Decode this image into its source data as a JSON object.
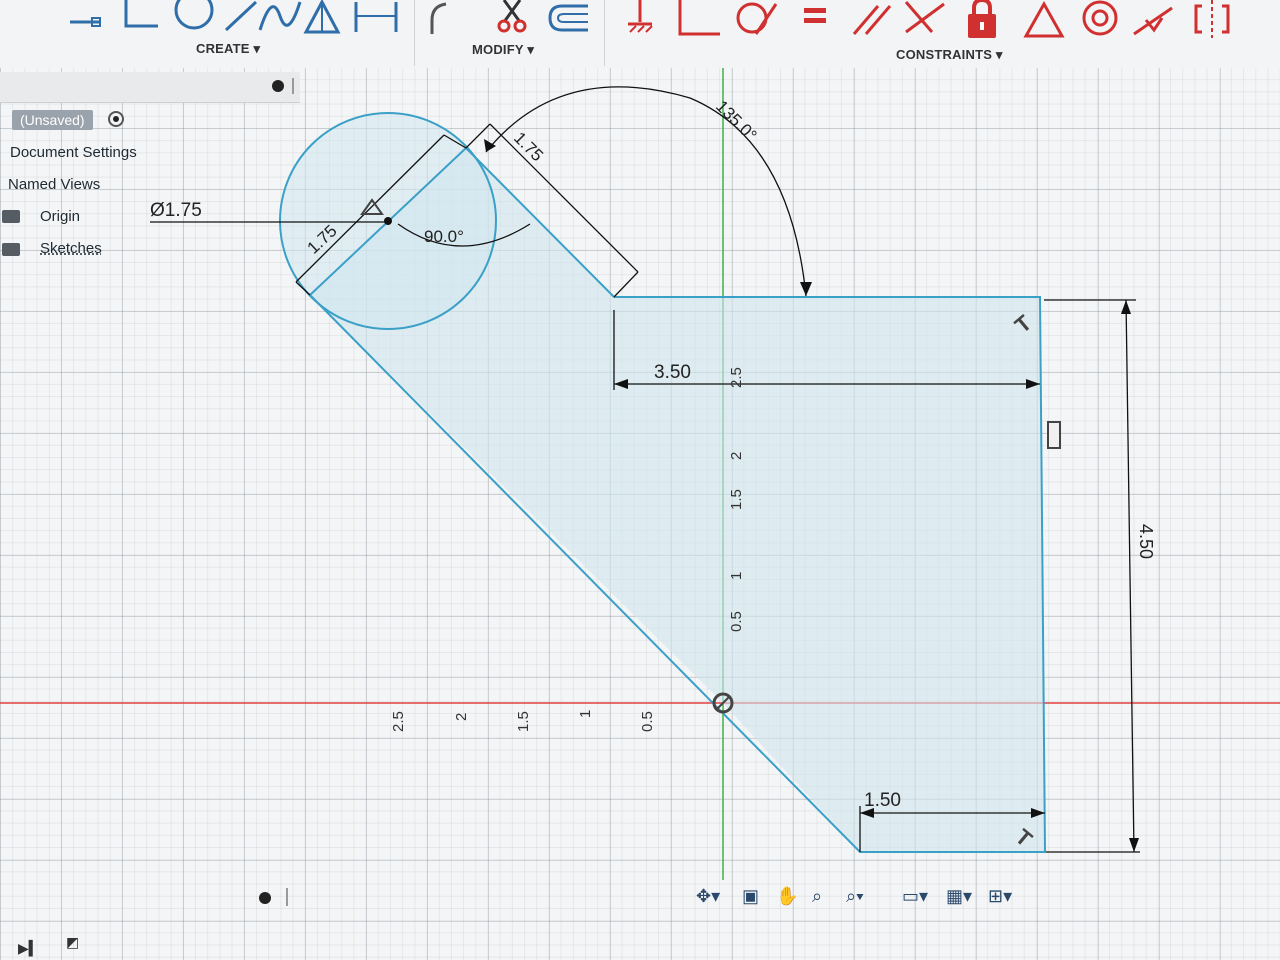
{
  "toolbar": {
    "groups": {
      "create": "CREATE ▾",
      "modify": "MODIFY ▾",
      "constraints": "CONSTRAINTS ▾"
    },
    "icons": [
      "line-icon",
      "rectangle-icon",
      "circle-icon",
      "diagonal-line-icon",
      "spline-icon",
      "triangle-slot-icon",
      "dimension-h-icon",
      "fillet-icon",
      "scissors-trim-icon",
      "offset-icon",
      "fix-constraint-icon",
      "perpendicular-icon",
      "tangent-icon",
      "equal-icon",
      "parallel-icon",
      "coincident-icon",
      "lock-icon",
      "triangle-icon",
      "concentric-icon",
      "midpoint-icon",
      "symmetry-icon"
    ]
  },
  "browser": {
    "document_name": "(Unsaved)",
    "items": [
      {
        "label": "Document Settings"
      },
      {
        "label": "Named Views"
      },
      {
        "label": "Origin"
      },
      {
        "label": "Sketches"
      }
    ]
  },
  "sketch": {
    "dimensions": {
      "circle_diameter": "Ø1.75",
      "left_length": "1.75",
      "top_length": "1.75",
      "angle_top": "135.0°",
      "angle_circle": "90.0°",
      "top_width": "3.50",
      "height": "4.50",
      "bottom_width": "1.50"
    },
    "axis_labels_vertical": [
      "2.5",
      "2",
      "1.5",
      "1",
      "0.5"
    ],
    "axis_labels_horizontal": [
      "2.5",
      "2",
      "1.5",
      "1",
      "0.5"
    ],
    "colors": {
      "profile_stroke": "#3aa0c8",
      "profile_fill": "#cfe6ef",
      "x_axis": "#e04040",
      "y_axis": "#3fb04a",
      "dimension": "#111111"
    }
  },
  "navbar": {
    "icons": [
      "orbit-icon",
      "look-at-icon",
      "pan-icon",
      "zoom-icon",
      "zoom-window-icon",
      "display-settings-icon",
      "grid-settings-icon",
      "viewports-icon"
    ]
  }
}
